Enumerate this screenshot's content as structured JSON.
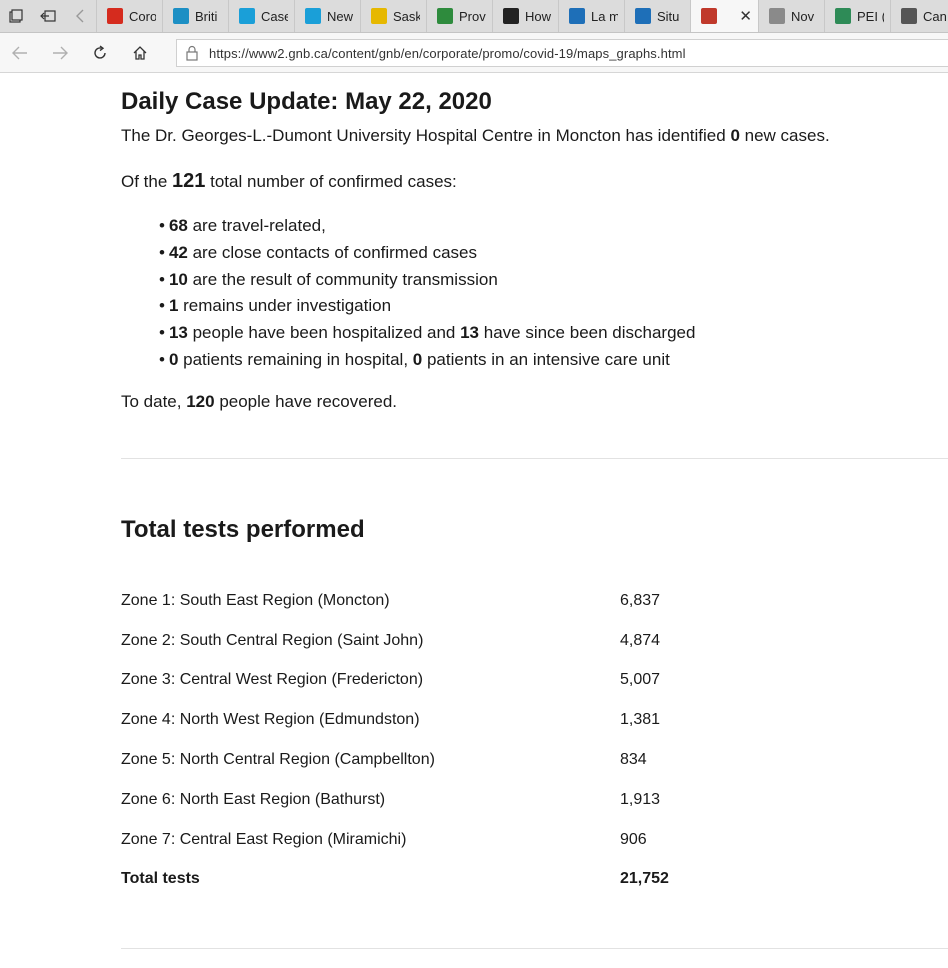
{
  "browser": {
    "tabs": [
      {
        "title": "Coro",
        "icon": "maple-leaf-icon",
        "color": "#d52b1e"
      },
      {
        "title": "Briti",
        "icon": "bc-gov-icon",
        "color": "#1c8fc4"
      },
      {
        "title": "Case",
        "icon": "alberta-icon",
        "color": "#1a9fd8"
      },
      {
        "title": "New",
        "icon": "alberta-icon",
        "color": "#1a9fd8"
      },
      {
        "title": "Sask",
        "icon": "sask-icon",
        "color": "#e6b800"
      },
      {
        "title": "Prov",
        "icon": "manitoba-icon",
        "color": "#2e8b3d"
      },
      {
        "title": "How",
        "icon": "ontario-icon",
        "color": "#222222"
      },
      {
        "title": "La m",
        "icon": "quebec-icon",
        "color": "#1e6fb8"
      },
      {
        "title": "Situ",
        "icon": "quebec-icon",
        "color": "#1e6fb8"
      },
      {
        "title": "",
        "icon": "nb-gov-icon",
        "color": "#c0392b",
        "active": true
      },
      {
        "title": "Nov",
        "icon": "ns-gov-icon",
        "color": "#8a8a8a"
      },
      {
        "title": "PEI (",
        "icon": "pei-gov-icon",
        "color": "#2e8b57"
      },
      {
        "title": "Can",
        "icon": "page-icon",
        "color": "#555555"
      }
    ],
    "url": "https://www2.gnb.ca/content/gnb/en/corporate/promo/covid-19/maps_graphs.html"
  },
  "update": {
    "heading": "Daily Case Update: May 22, 2020",
    "intro_prefix": "The Dr. Georges-L.-Dumont University Hospital Centre in Moncton has identified ",
    "intro_count": "0",
    "intro_suffix": " new cases.",
    "total_prefix": "Of the ",
    "total_count": "121",
    "total_suffix": " total number of confirmed cases:",
    "bullets": [
      {
        "n1": "68",
        "t1": " are travel-related,",
        "n2": "",
        "t2": ""
      },
      {
        "n1": "42",
        "t1": " are close contacts of confirmed cases",
        "n2": "",
        "t2": ""
      },
      {
        "n1": "10",
        "t1": " are the result of community transmission",
        "n2": "",
        "t2": ""
      },
      {
        "n1": "1",
        "t1": " remains under investigation",
        "n2": "",
        "t2": ""
      },
      {
        "n1": "13",
        "t1": " people have been hospitalized and ",
        "n2": "13",
        "t2": " have since been discharged"
      },
      {
        "n1": "0",
        "t1": " patients remaining in hospital, ",
        "n2": "0",
        "t2": " patients in an intensive care unit"
      }
    ],
    "recovered_prefix": "To date, ",
    "recovered_count": "120",
    "recovered_suffix": " people have recovered."
  },
  "tests": {
    "heading": "Total tests performed",
    "rows": [
      {
        "zone": "Zone 1: South East Region (Moncton)",
        "value": "6,837"
      },
      {
        "zone": "Zone 2: South Central Region (Saint John)",
        "value": "4,874"
      },
      {
        "zone": "Zone 3: Central West Region (Fredericton)",
        "value": "5,007"
      },
      {
        "zone": "Zone 4: North West Region (Edmundston)",
        "value": "1,381"
      },
      {
        "zone": "Zone 5: North Central Region (Campbellton)",
        "value": "834"
      },
      {
        "zone": "Zone 6: North East Region (Bathurst)",
        "value": "1,913"
      },
      {
        "zone": "Zone 7: Central East Region (Miramichi)",
        "value": "906"
      }
    ],
    "total_label": "Total tests",
    "total_value": "21,752"
  }
}
